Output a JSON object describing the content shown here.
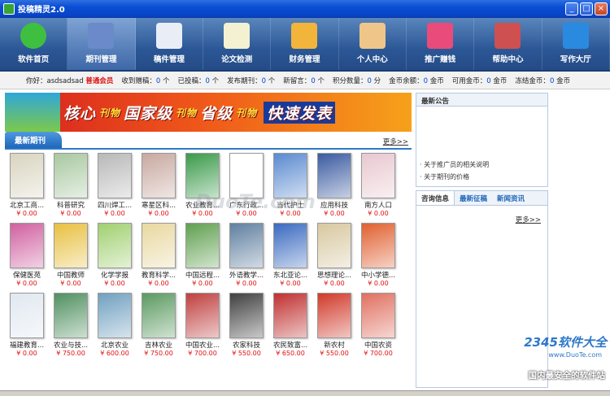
{
  "window": {
    "title": "投稿精灵2.0",
    "buttons": [
      "_",
      "□",
      "×"
    ]
  },
  "nav": [
    {
      "label": "软件首页",
      "icon": "home-arrow-icon",
      "color": "#3fbf3f"
    },
    {
      "label": "期刊管理",
      "icon": "monitor-icon",
      "color": "#6a8ac9",
      "active": true
    },
    {
      "label": "稿件管理",
      "icon": "calendar-icon",
      "color": "#e9eef6"
    },
    {
      "label": "论文检测",
      "icon": "pencil-paper-icon",
      "color": "#f3f1d2"
    },
    {
      "label": "财务管理",
      "icon": "blocks-icon",
      "color": "#f2b43a"
    },
    {
      "label": "个人中心",
      "icon": "user-icon",
      "color": "#f0c58a"
    },
    {
      "label": "推广赚钱",
      "icon": "heart-icon",
      "color": "#e94b7a"
    },
    {
      "label": "帮助中心",
      "icon": "user-search-icon",
      "color": "#cf5050"
    },
    {
      "label": "写作大厅",
      "icon": "safari-compass-icon",
      "color": "#2a8ae0"
    }
  ],
  "status": {
    "greeting": "你好：asdsadsad",
    "member": "普通会员",
    "items": [
      {
        "label": "收到赠稿：",
        "value": "0",
        "unit": "个"
      },
      {
        "label": "已投稿：",
        "value": "0",
        "unit": "个"
      },
      {
        "label": "发布期刊：",
        "value": "0",
        "unit": "个"
      },
      {
        "label": "新留言：",
        "value": "0",
        "unit": "个"
      },
      {
        "label": "积分数量：",
        "value": "0",
        "unit": "分"
      },
      {
        "label": "金币余额：",
        "value": "0",
        "unit": "金币"
      },
      {
        "label": "可用金币：",
        "value": "0",
        "unit": "金币"
      },
      {
        "label": "冻结金币：",
        "value": "0",
        "unit": "金币"
      }
    ]
  },
  "banner": {
    "parts": [
      "核心",
      "刊物",
      "国家级",
      "刊物",
      "省级",
      "刊物",
      "快速发表"
    ]
  },
  "latest": {
    "title": "最新期刊",
    "more": "更多>>"
  },
  "journals": [
    {
      "name": "北京工商...",
      "price": "¥ 0.00",
      "color": "#d9d4c0"
    },
    {
      "name": "科普研究",
      "price": "¥ 0.00",
      "color": "#a8c8a0"
    },
    {
      "name": "四川焊工...",
      "price": "¥ 0.00",
      "color": "#b8b8b8"
    },
    {
      "name": "寒星区科...",
      "price": "¥ 0.00",
      "color": "#c8a8a0"
    },
    {
      "name": "农业教育...",
      "price": "¥ 0.00",
      "color": "#3a9a4a"
    },
    {
      "name": "广东行政...",
      "price": "¥ 0.00",
      "color": "#ffffff"
    },
    {
      "name": "当代护士",
      "price": "¥ 0.00",
      "color": "#5a8ad0"
    },
    {
      "name": "应用科技",
      "price": "¥ 0.00",
      "color": "#3a5aa0"
    },
    {
      "name": "南方人口",
      "price": "¥ 0.00",
      "color": "#e8c8d0"
    },
    {
      "name": "保健医苑",
      "price": "¥ 0.00",
      "color": "#d060a0"
    },
    {
      "name": "中国教师",
      "price": "¥ 0.00",
      "color": "#e8c040"
    },
    {
      "name": "化学学报",
      "price": "¥ 0.00",
      "color": "#a0d070"
    },
    {
      "name": "教育科学...",
      "price": "¥ 0.00",
      "color": "#e8d8a0"
    },
    {
      "name": "中国远程...",
      "price": "¥ 0.00",
      "color": "#60a050"
    },
    {
      "name": "外语教学...",
      "price": "¥ 0.00",
      "color": "#6080a0"
    },
    {
      "name": "东北亚论...",
      "price": "¥ 0.00",
      "color": "#3a6ac0"
    },
    {
      "name": "思想理论...",
      "price": "¥ 0.00",
      "color": "#d8c8a0"
    },
    {
      "name": "中小学德...",
      "price": "¥ 0.00",
      "color": "#e06030"
    },
    {
      "name": "福建教育...",
      "price": "¥ 0.00",
      "color": "#e0e8f0"
    },
    {
      "name": "农业与技...",
      "price": "¥ 750.00",
      "color": "#509060"
    },
    {
      "name": "北京农业",
      "price": "¥ 600.00",
      "color": "#70a0c0"
    },
    {
      "name": "吉林农业",
      "price": "¥ 750.00",
      "color": "#5a9a60"
    },
    {
      "name": "中国农业...",
      "price": "¥ 700.00",
      "color": "#c04040"
    },
    {
      "name": "农家科技",
      "price": "¥ 550.00",
      "color": "#404040"
    },
    {
      "name": "农民致富...",
      "price": "¥ 650.00",
      "color": "#c03030"
    },
    {
      "name": "新农村",
      "price": "¥ 550.00",
      "color": "#d03a2a"
    },
    {
      "name": "中国农资",
      "price": "¥ 700.00",
      "color": "#e07060"
    }
  ],
  "announcements": {
    "title": "最新公告",
    "links": [
      "· 关于推广员的相关说明",
      "· 关于期刊的价格"
    ]
  },
  "infotabs": {
    "tabs": [
      "咨询信息",
      "最新征稿",
      "新闻资讯"
    ],
    "more": "更多>>"
  },
  "watermark": {
    "brand": "2345软件大全",
    "url": "www.DuoTe.com",
    "slogan": "国内最安全的软件站",
    "center": "DuoTe.com"
  }
}
